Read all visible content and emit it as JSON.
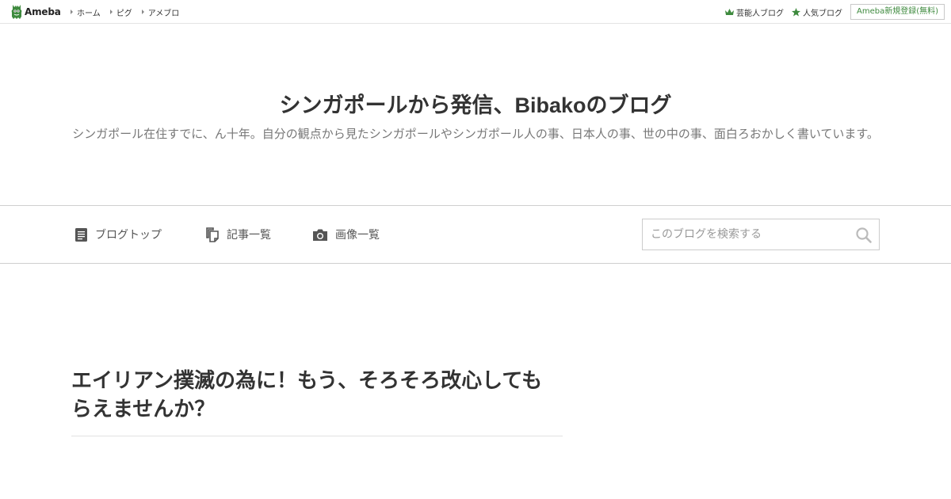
{
  "topbar": {
    "logo_text": "Ameba",
    "nav": [
      {
        "label": "ホーム"
      },
      {
        "label": "ピグ"
      },
      {
        "label": "アメブロ"
      }
    ],
    "celebrity_blog": "芸能人ブログ",
    "popular_blog": "人気ブログ",
    "signup": "Ameba新規登録(無料)",
    "accent_color": "#3e8a3e"
  },
  "header": {
    "title": "シンガポールから発信、Bibakoのブログ",
    "description": "シンガポール在住すでに、ん十年。自分の観点から見たシンガポールやシンガポール人の事、日本人の事、世の中の事、面白ろおかしく書いています。"
  },
  "blognav": {
    "items": [
      {
        "label": "ブログトップ",
        "icon": "document-icon"
      },
      {
        "label": "記事一覧",
        "icon": "copy-icon"
      },
      {
        "label": "画像一覧",
        "icon": "camera-icon"
      }
    ],
    "search": {
      "placeholder": "このブログを検索する",
      "value": ""
    }
  },
  "article": {
    "title": "エイリアン撲滅の為に！もう、そろそろ改心してもらえませんか？"
  }
}
